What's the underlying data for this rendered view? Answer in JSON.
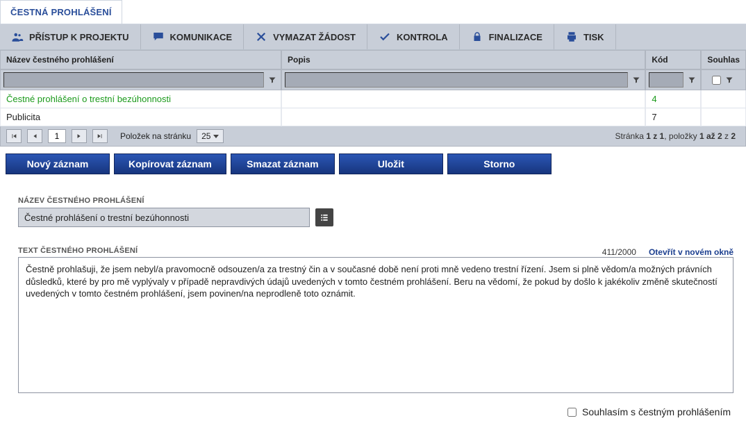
{
  "tab": {
    "label": "ČESTNÁ PROHLÁŠENÍ"
  },
  "toolbar": {
    "items": [
      {
        "label": "PŘÍSTUP K PROJEKTU"
      },
      {
        "label": "KOMUNIKACE"
      },
      {
        "label": "VYMAZAT ŽÁDOST"
      },
      {
        "label": "KONTROLA"
      },
      {
        "label": "FINALIZACE"
      },
      {
        "label": "TISK"
      }
    ]
  },
  "grid": {
    "columns": {
      "name": "Název čestného prohlášení",
      "desc": "Popis",
      "code": "Kód",
      "consent": "Souhlas"
    },
    "rows": [
      {
        "name": "Čestné prohlášení o trestní bezúhonnosti",
        "desc": "",
        "code": "4",
        "consent": ""
      },
      {
        "name": "Publicita",
        "desc": "",
        "code": "7",
        "consent": ""
      }
    ]
  },
  "paging": {
    "current": "1",
    "perPageLabel": "Položek na stránku",
    "perPage": "25",
    "infoPrefix": "Stránka ",
    "pageBold": "1 z 1",
    "infoMid": ", položky ",
    "itemsBold": "1 až 2",
    "infoSuffix": " z ",
    "totalBold": "2"
  },
  "actions": {
    "new": "Nový záznam",
    "copy": "Kopírovat záznam",
    "delete": "Smazat záznam",
    "save": "Uložit",
    "cancel": "Storno"
  },
  "form": {
    "nameLabel": "NÁZEV ČESTNÉHO PROHLÁŠENÍ",
    "nameValue": "Čestné prohlášení o trestní bezúhonnosti",
    "textLabel": "TEXT ČESTNÉHO PROHLÁŠENÍ",
    "counter": "411/2000",
    "openNew": "Otevřít v novém okně",
    "textValue": "Čestně prohlašuji, že jsem nebyl/a pravomocně odsouzen/a za trestný čin a v současné době není proti mně vedeno trestní řízení. Jsem si plně vědom/a možných právních důsledků, které by pro mě vyplývaly v případě nepravdivých údajů uvedených v tomto čestném prohlášení. Beru na vědomí, že pokud by došlo k jakékoliv změně skutečností uvedených v tomto čestném prohlášení, jsem povinen/na neprodleně toto oznámit.",
    "consentLabel": "Souhlasím s čestným prohlášením"
  }
}
